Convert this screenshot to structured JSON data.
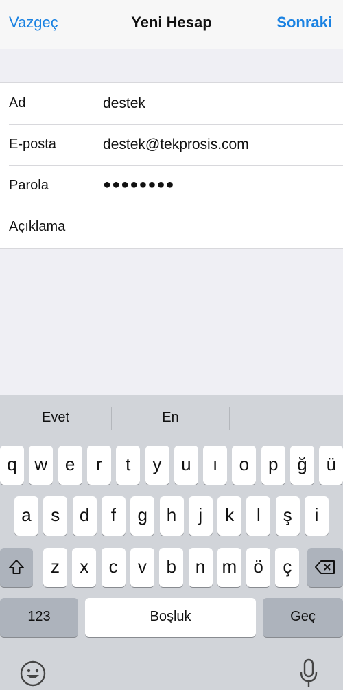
{
  "nav": {
    "cancel": "Vazgeç",
    "title": "Yeni Hesap",
    "next": "Sonraki"
  },
  "form": {
    "rows": [
      {
        "label": "Ad",
        "value": "destek"
      },
      {
        "label": "E-posta",
        "value": "destek@tekprosis.com"
      },
      {
        "label": "Parola",
        "value": "●●●●●●●●"
      },
      {
        "label": "Açıklama",
        "value": ""
      }
    ]
  },
  "keyboard": {
    "suggestions": [
      "Evet",
      "En",
      ""
    ],
    "row1": [
      "q",
      "w",
      "e",
      "r",
      "t",
      "y",
      "u",
      "ı",
      "o",
      "p",
      "ğ",
      "ü"
    ],
    "row2": [
      "a",
      "s",
      "d",
      "f",
      "g",
      "h",
      "j",
      "k",
      "l",
      "ş",
      "i"
    ],
    "row3": [
      "z",
      "x",
      "c",
      "v",
      "b",
      "n",
      "m",
      "ö",
      "ç"
    ],
    "numbers_label": "123",
    "space_label": "Boşluk",
    "go_label": "Geç",
    "shift_icon": "shift-icon",
    "backspace_icon": "backspace-icon",
    "emoji_icon": "emoji-icon",
    "mic_icon": "microphone-icon"
  },
  "colors": {
    "accent": "#1a82e2"
  }
}
